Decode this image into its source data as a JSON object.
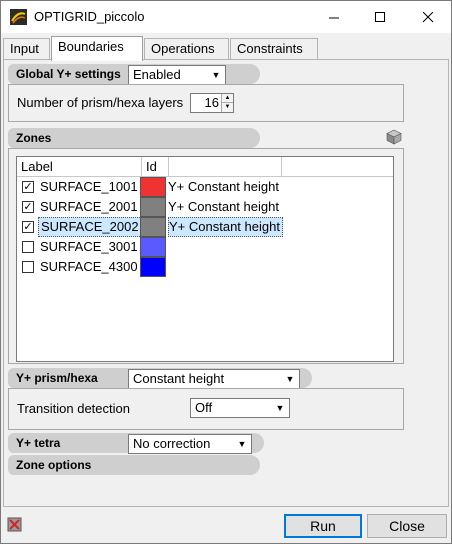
{
  "window": {
    "title": "OPTIGRID_piccolo"
  },
  "tabs": [
    {
      "label": "Input"
    },
    {
      "label": "Boundaries"
    },
    {
      "label": "Operations"
    },
    {
      "label": "Constraints"
    }
  ],
  "global_yplus": {
    "header": "Global Y+ settings",
    "enabled_value": "Enabled",
    "layers_label": "Number of prism/hexa layers",
    "layers_value": "16"
  },
  "zones": {
    "header": "Zones",
    "icon": "cube-icon",
    "columns": [
      "Label",
      "Id"
    ],
    "rows": [
      {
        "label": "SURFACE_1001",
        "checked": true,
        "color": "#f03232",
        "mode": "Y+ Constant height",
        "selected": false
      },
      {
        "label": "SURFACE_2001",
        "checked": true,
        "color": "#808080",
        "mode": "Y+ Constant height",
        "selected": false
      },
      {
        "label": "SURFACE_2002",
        "checked": true,
        "color": "#808080",
        "mode": "Y+ Constant height",
        "selected": true
      },
      {
        "label": "SURFACE_3001",
        "checked": false,
        "color": "#5a5aff",
        "mode": "",
        "selected": false
      },
      {
        "label": "SURFACE_4300",
        "checked": false,
        "color": "#0000ff",
        "mode": "",
        "selected": false
      }
    ]
  },
  "yplus_prism": {
    "header": "Y+ prism/hexa",
    "value": "Constant height",
    "transition_label": "Transition detection",
    "transition_value": "Off"
  },
  "yplus_tetra": {
    "header": "Y+ tetra",
    "value": "No correction"
  },
  "zone_options": {
    "header": "Zone options"
  },
  "footer": {
    "run_label": "Run",
    "close_label": "Close"
  }
}
